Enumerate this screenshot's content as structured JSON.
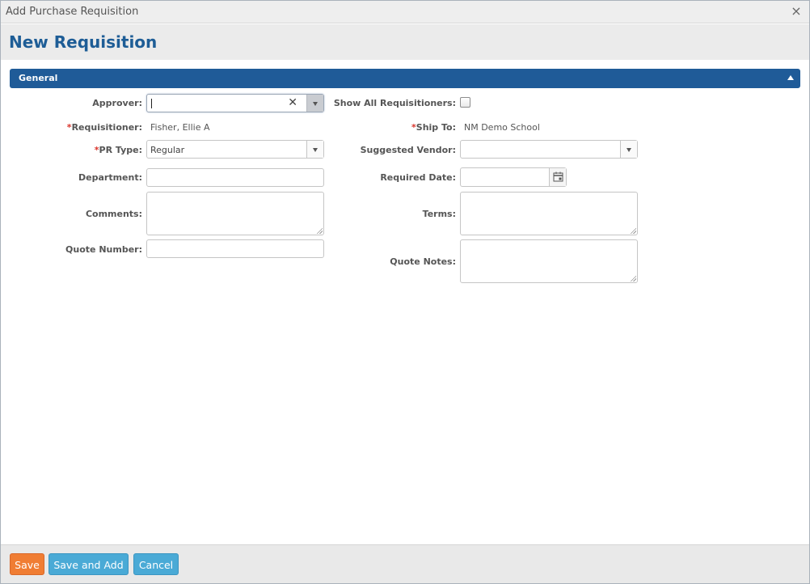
{
  "window": {
    "title": "Add Purchase Requisition",
    "close_glyph": "×"
  },
  "page": {
    "heading": "New Requisition"
  },
  "section": {
    "title": "General"
  },
  "form": {
    "approver": {
      "label": "Approver:",
      "value": ""
    },
    "show_all": {
      "label": "Show All Requisitioners:",
      "checked": false
    },
    "requisitioner": {
      "required_mark": "*",
      "label": "Requisitioner:",
      "value": "Fisher, Ellie A"
    },
    "ship_to": {
      "required_mark": "*",
      "label": "Ship To:",
      "value": "NM Demo School"
    },
    "pr_type": {
      "required_mark": "*",
      "label": "PR Type:",
      "value": "Regular"
    },
    "suggested_vendor": {
      "label": "Suggested Vendor:",
      "value": ""
    },
    "department": {
      "label": "Department:",
      "value": ""
    },
    "required_date": {
      "label": "Required Date:",
      "value": ""
    },
    "comments": {
      "label": "Comments:",
      "value": ""
    },
    "terms": {
      "label": "Terms:",
      "value": ""
    },
    "quote_number": {
      "label": "Quote Number:",
      "value": ""
    },
    "quote_notes": {
      "label": "Quote Notes:",
      "value": ""
    }
  },
  "footer": {
    "save": "Save",
    "save_and_add": "Save and Add",
    "cancel": "Cancel"
  },
  "colors": {
    "heading": "#1e5d96",
    "section_bar": "#1f5b98",
    "save_button": "#f07d33",
    "secondary_button": "#4aaad6",
    "required_mark": "#d9342b"
  },
  "icons": {
    "close": "close-icon",
    "collapse": "chevron-up-icon",
    "clear": "clear-icon",
    "dropdown": "chevron-down-icon",
    "calendar": "calendar-icon"
  }
}
